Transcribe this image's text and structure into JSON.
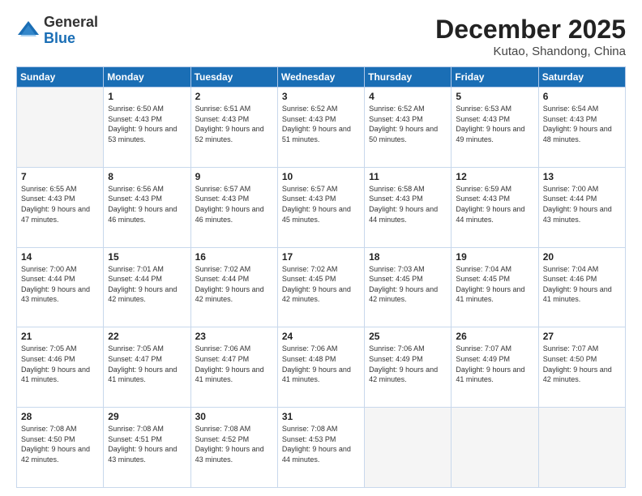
{
  "logo": {
    "general": "General",
    "blue": "Blue"
  },
  "header": {
    "month": "December 2025",
    "location": "Kutao, Shandong, China"
  },
  "weekdays": [
    "Sunday",
    "Monday",
    "Tuesday",
    "Wednesday",
    "Thursday",
    "Friday",
    "Saturday"
  ],
  "weeks": [
    [
      {
        "day": "",
        "empty": true
      },
      {
        "day": "1",
        "sunrise": "6:50 AM",
        "sunset": "4:43 PM",
        "daylight": "9 hours and 53 minutes."
      },
      {
        "day": "2",
        "sunrise": "6:51 AM",
        "sunset": "4:43 PM",
        "daylight": "9 hours and 52 minutes."
      },
      {
        "day": "3",
        "sunrise": "6:52 AM",
        "sunset": "4:43 PM",
        "daylight": "9 hours and 51 minutes."
      },
      {
        "day": "4",
        "sunrise": "6:52 AM",
        "sunset": "4:43 PM",
        "daylight": "9 hours and 50 minutes."
      },
      {
        "day": "5",
        "sunrise": "6:53 AM",
        "sunset": "4:43 PM",
        "daylight": "9 hours and 49 minutes."
      },
      {
        "day": "6",
        "sunrise": "6:54 AM",
        "sunset": "4:43 PM",
        "daylight": "9 hours and 48 minutes."
      }
    ],
    [
      {
        "day": "7",
        "sunrise": "6:55 AM",
        "sunset": "4:43 PM",
        "daylight": "9 hours and 47 minutes."
      },
      {
        "day": "8",
        "sunrise": "6:56 AM",
        "sunset": "4:43 PM",
        "daylight": "9 hours and 46 minutes."
      },
      {
        "day": "9",
        "sunrise": "6:57 AM",
        "sunset": "4:43 PM",
        "daylight": "9 hours and 46 minutes."
      },
      {
        "day": "10",
        "sunrise": "6:57 AM",
        "sunset": "4:43 PM",
        "daylight": "9 hours and 45 minutes."
      },
      {
        "day": "11",
        "sunrise": "6:58 AM",
        "sunset": "4:43 PM",
        "daylight": "9 hours and 44 minutes."
      },
      {
        "day": "12",
        "sunrise": "6:59 AM",
        "sunset": "4:43 PM",
        "daylight": "9 hours and 44 minutes."
      },
      {
        "day": "13",
        "sunrise": "7:00 AM",
        "sunset": "4:44 PM",
        "daylight": "9 hours and 43 minutes."
      }
    ],
    [
      {
        "day": "14",
        "sunrise": "7:00 AM",
        "sunset": "4:44 PM",
        "daylight": "9 hours and 43 minutes."
      },
      {
        "day": "15",
        "sunrise": "7:01 AM",
        "sunset": "4:44 PM",
        "daylight": "9 hours and 42 minutes."
      },
      {
        "day": "16",
        "sunrise": "7:02 AM",
        "sunset": "4:44 PM",
        "daylight": "9 hours and 42 minutes."
      },
      {
        "day": "17",
        "sunrise": "7:02 AM",
        "sunset": "4:45 PM",
        "daylight": "9 hours and 42 minutes."
      },
      {
        "day": "18",
        "sunrise": "7:03 AM",
        "sunset": "4:45 PM",
        "daylight": "9 hours and 42 minutes."
      },
      {
        "day": "19",
        "sunrise": "7:04 AM",
        "sunset": "4:45 PM",
        "daylight": "9 hours and 41 minutes."
      },
      {
        "day": "20",
        "sunrise": "7:04 AM",
        "sunset": "4:46 PM",
        "daylight": "9 hours and 41 minutes."
      }
    ],
    [
      {
        "day": "21",
        "sunrise": "7:05 AM",
        "sunset": "4:46 PM",
        "daylight": "9 hours and 41 minutes."
      },
      {
        "day": "22",
        "sunrise": "7:05 AM",
        "sunset": "4:47 PM",
        "daylight": "9 hours and 41 minutes."
      },
      {
        "day": "23",
        "sunrise": "7:06 AM",
        "sunset": "4:47 PM",
        "daylight": "9 hours and 41 minutes."
      },
      {
        "day": "24",
        "sunrise": "7:06 AM",
        "sunset": "4:48 PM",
        "daylight": "9 hours and 41 minutes."
      },
      {
        "day": "25",
        "sunrise": "7:06 AM",
        "sunset": "4:49 PM",
        "daylight": "9 hours and 42 minutes."
      },
      {
        "day": "26",
        "sunrise": "7:07 AM",
        "sunset": "4:49 PM",
        "daylight": "9 hours and 41 minutes."
      },
      {
        "day": "27",
        "sunrise": "7:07 AM",
        "sunset": "4:50 PM",
        "daylight": "9 hours and 42 minutes."
      }
    ],
    [
      {
        "day": "28",
        "sunrise": "7:08 AM",
        "sunset": "4:50 PM",
        "daylight": "9 hours and 42 minutes."
      },
      {
        "day": "29",
        "sunrise": "7:08 AM",
        "sunset": "4:51 PM",
        "daylight": "9 hours and 43 minutes."
      },
      {
        "day": "30",
        "sunrise": "7:08 AM",
        "sunset": "4:52 PM",
        "daylight": "9 hours and 43 minutes."
      },
      {
        "day": "31",
        "sunrise": "7:08 AM",
        "sunset": "4:53 PM",
        "daylight": "9 hours and 44 minutes."
      },
      {
        "day": "",
        "empty": true
      },
      {
        "day": "",
        "empty": true
      },
      {
        "day": "",
        "empty": true
      }
    ]
  ]
}
